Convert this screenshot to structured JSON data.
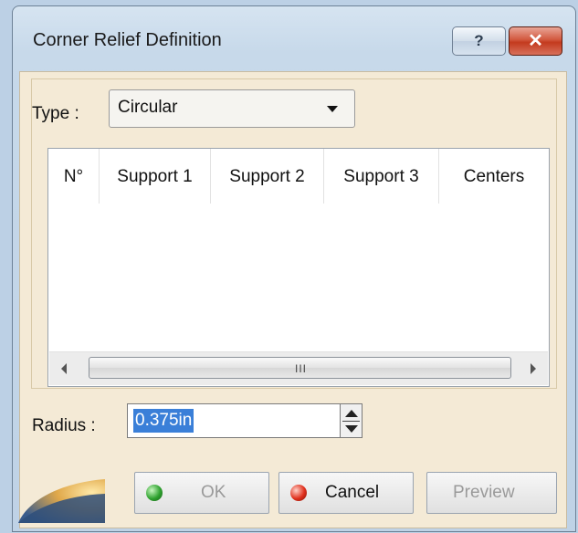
{
  "window": {
    "title": "Corner Relief Definition",
    "help_label": "?",
    "close_label": "✕"
  },
  "type_field": {
    "label": "Type :",
    "value": "Circular"
  },
  "table": {
    "columns": [
      "N°",
      "Support 1",
      "Support 2",
      "Support 3",
      "Centers"
    ],
    "rows": [],
    "scroll_grip": "III"
  },
  "radius_field": {
    "label": "Radius :",
    "value": "0.375in"
  },
  "buttons": {
    "ok_label": "OK",
    "cancel_label": "Cancel",
    "preview_label": "Preview"
  },
  "colors": {
    "panel": "#f4ead6",
    "selection": "#3a7fd8",
    "close": "#c33a1e"
  }
}
